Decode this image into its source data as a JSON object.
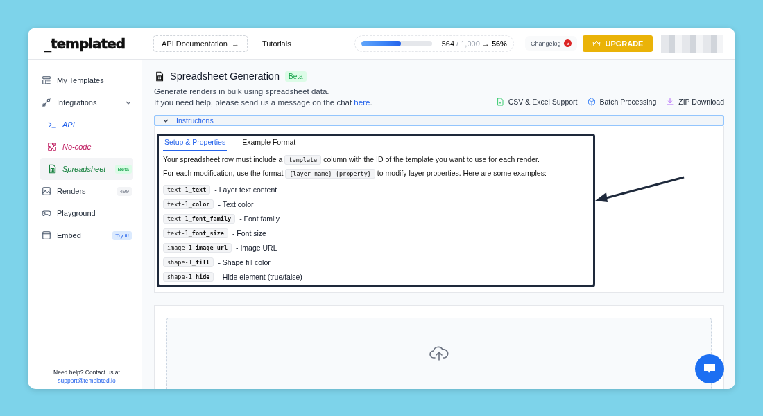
{
  "logo": "_templated",
  "header": {
    "links": [
      {
        "label": "API Documentation",
        "kind": "outlined",
        "arrow": "→"
      },
      {
        "label": "Tutorials",
        "kind": "plain"
      }
    ],
    "usage": {
      "level": 0.56,
      "used": "564",
      "total": "/ 1,000",
      "arrow": "→",
      "percent": "56%"
    },
    "changelog": {
      "label": "Changelog",
      "count": "3"
    },
    "upgrade": "UPGRADE"
  },
  "sidebar": {
    "items": [
      {
        "label": "My Templates",
        "selected": false
      },
      {
        "label": "Integrations",
        "selected": false,
        "expanded": true,
        "children": [
          {
            "label": "API",
            "selected": false
          },
          {
            "label": "No-code",
            "selected": false
          },
          {
            "label": "Spreadsheet",
            "selected": true,
            "badge": {
              "text": "Beta",
              "kind": "green"
            }
          }
        ]
      },
      {
        "label": "Renders",
        "selected": false,
        "badge": {
          "text": "499",
          "kind": "gray"
        }
      },
      {
        "label": "Playground",
        "selected": false
      },
      {
        "label": "Embed",
        "selected": false,
        "badge": {
          "text": "Try it!",
          "kind": "blue"
        }
      }
    ],
    "help": "Need help? Contact us at",
    "email": "support@templated.io"
  },
  "page": {
    "title": "Spreadsheet Generation",
    "badge": "Beta",
    "lines": [
      "Generate renders in bulk using spreadsheet data."
    ],
    "help_text": "If you need help, please send us a message on the chat ",
    "help_link": "here",
    "help_end": ".",
    "features": [
      {
        "label": "CSV & Excel Support"
      },
      {
        "label": "Batch Processing"
      },
      {
        "label": "ZIP Download"
      }
    ]
  },
  "instructions": {
    "label": "Instructions",
    "expanded": true,
    "tabs": [
      {
        "label": "Setup & Properties",
        "selected": true
      },
      {
        "label": "Example Format",
        "selected": false
      }
    ],
    "intro": [
      {
        "before": "Your spreadsheet row must include a ",
        "code": "template",
        "after": " column with the ID of the template you want to use for each render."
      },
      {
        "before": "For each modification, use the format ",
        "code": "{layer-name}_{property}",
        "after": " to modify layer properties. Here are some examples:"
      }
    ],
    "examples": [
      {
        "code": "text-1_**text**",
        "desc": "- Layer text content"
      },
      {
        "code": "text-1_**color**",
        "desc": "- Text color"
      },
      {
        "code": "text-1_**font_family**",
        "desc": "- Font family"
      },
      {
        "code": "text-1_**font_size**",
        "desc": "- Font size"
      },
      {
        "code": "image-1_**image_url**",
        "desc": "- Image URL"
      },
      {
        "code": "shape-1_**fill**",
        "desc": "- Shape fill color"
      },
      {
        "code": "shape-1_**hide**",
        "desc": "- Hide element (true/false)"
      }
    ]
  }
}
